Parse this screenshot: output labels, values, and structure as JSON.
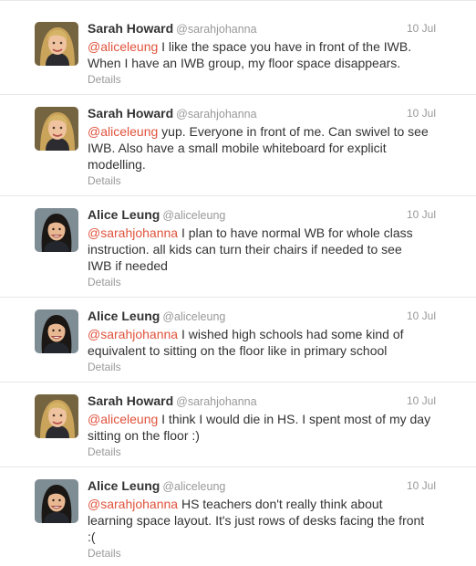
{
  "colors": {
    "mention": "#e0533d",
    "meta_text": "#999999",
    "body_text": "#333333",
    "divider": "#e8e8e8"
  },
  "tweets": [
    {
      "avatar_icon": "sarah-avatar",
      "name": "Sarah Howard",
      "handle": "@sarahjohanna",
      "time": "10 Jul",
      "mention": "@aliceleung",
      "line1_rest": " I like the space you have in front of the IWB.",
      "line2": "When I have an IWB group, my floor space disappears.",
      "line3": "",
      "details": "Details"
    },
    {
      "avatar_icon": "sarah-avatar",
      "name": "Sarah Howard",
      "handle": "@sarahjohanna",
      "time": "10 Jul",
      "mention": "@aliceleung",
      "line1_rest": " yup. Everyone in front of me. Can swivel to see",
      "line2": "IWB. Also have a small mobile whiteboard for explicit",
      "line3": "modelling.",
      "details": "Details"
    },
    {
      "avatar_icon": "alice-avatar",
      "name": "Alice Leung",
      "handle": "@aliceleung",
      "time": "10 Jul",
      "mention": "@sarahjohanna",
      "line1_rest": " I plan to have normal WB for whole class",
      "line2": "instruction. all kids can turn their chairs if needed to see",
      "line3": "IWB if needed",
      "details": "Details"
    },
    {
      "avatar_icon": "alice-avatar",
      "name": "Alice Leung",
      "handle": "@aliceleung",
      "time": "10 Jul",
      "mention": "@sarahjohanna",
      "line1_rest": " I wished high schools had some kind of",
      "line2": "equivalent to sitting on the floor like in primary school",
      "line3": "",
      "details": "Details"
    },
    {
      "avatar_icon": "sarah-avatar",
      "name": "Sarah Howard",
      "handle": "@sarahjohanna",
      "time": "10 Jul",
      "mention": "@aliceleung",
      "line1_rest": " I think I would die in HS. I spent most of my day",
      "line2": "sitting on the floor :)",
      "line3": "",
      "details": "Details"
    },
    {
      "avatar_icon": "alice-avatar",
      "name": "Alice Leung",
      "handle": "@aliceleung",
      "time": "10 Jul",
      "mention": "@sarahjohanna",
      "line1_rest": " HS teachers don't really think about",
      "line2": "learning space layout. It's just rows of desks facing the front",
      "line3": ":(",
      "details": "Details"
    }
  ]
}
